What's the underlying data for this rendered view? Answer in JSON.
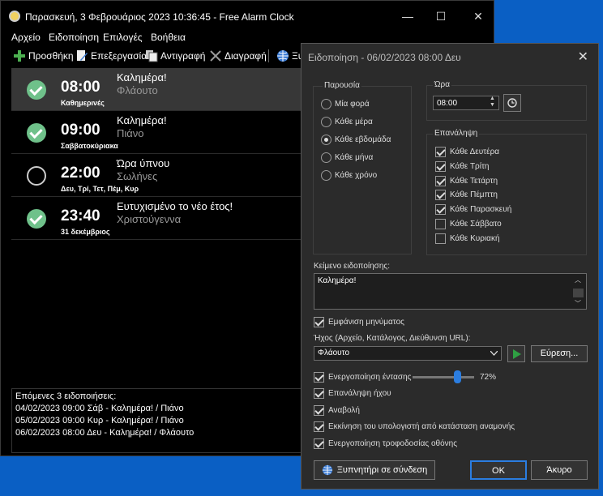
{
  "window": {
    "title": "Παρασκευή, 3 Φεβρουάριος 2023 10:36:45 - Free Alarm Clock",
    "minimize": "—",
    "maximize": "☐",
    "close": "✕"
  },
  "menu": [
    "Αρχείο",
    "Ειδοποίηση",
    "Επιλογές",
    "Βοήθεια"
  ],
  "toolbar": {
    "add": "Προσθήκη",
    "edit": "Επεξεργασία",
    "copy": "Αντιγραφή",
    "delete": "Διαγραφή",
    "wake": "Ξυ"
  },
  "alarms": [
    {
      "time": "08:00",
      "days": "Καθημερινές",
      "message": "Καλημέρα!",
      "sound": "Φλάουτο",
      "enabled": true
    },
    {
      "time": "09:00",
      "days": "Σαββατοκύριακα",
      "message": "Καλημέρα!",
      "sound": "Πιάνο",
      "enabled": true
    },
    {
      "time": "22:00",
      "days": "Δευ, Τρί, Τετ, Πέμ, Κυρ",
      "message": "Ώρα ύπνου",
      "sound": "Σωλήνες",
      "enabled": false
    },
    {
      "time": "23:40",
      "days": "31 δεκέμβριος",
      "message": "Ευτυχισμένο το νέο έτος!",
      "sound": "Χριστούγεννα",
      "enabled": true
    }
  ],
  "upcoming": {
    "header": "Επόμενες 3 ειδοποιήσεις:",
    "items": [
      "04/02/2023 09:00 Σάβ - Καλημέρα! / Πιάνο",
      "05/02/2023 09:00 Κυρ - Καλημέρα! / Πιάνο",
      "06/02/2023 08:00 Δευ - Καλημέρα! / Φλάουτο"
    ]
  },
  "dialog": {
    "title": "Ειδοποίηση - 06/02/2023 08:00 Δευ",
    "close": "✕",
    "recurrence_label": "Παρουσία",
    "recurrence": [
      "Μία φορά",
      "Κάθε μέρα",
      "Κάθε εβδομάδα",
      "Κάθε μήνα",
      "Κάθε χρόνο"
    ],
    "recurrence_selected": 2,
    "time_label": "Ώρα",
    "time_value": "08:00",
    "repeat_label": "Επανάληψη",
    "days": [
      {
        "label": "Κάθε Δευτέρα",
        "checked": true
      },
      {
        "label": "Κάθε Τρίτη",
        "checked": true
      },
      {
        "label": "Κάθε Τετάρτη",
        "checked": true
      },
      {
        "label": "Κάθε Πέμπτη",
        "checked": true
      },
      {
        "label": "Κάθε Παρασκευή",
        "checked": true
      },
      {
        "label": "Κάθε Σάββατο",
        "checked": false
      },
      {
        "label": "Κάθε Κυριακή",
        "checked": false
      }
    ],
    "message_label": "Κείμενο ειδοποίησης:",
    "message_value": "Καλημέρα!",
    "show_message": "Εμφάνιση μηνύματος",
    "sound_label": "Ήχος (Αρχείο, Κατάλογος, Διεύθυνση URL):",
    "sound_value": "Φλάουτο",
    "browse": "Εύρεση...",
    "volume_label": "Ενεργοποίηση έντασης",
    "volume_value": "72%",
    "volume_fraction": 0.72,
    "options": [
      {
        "label": "Επανάληψη ήχου",
        "checked": true
      },
      {
        "label": "Αναβολή",
        "checked": true
      },
      {
        "label": "Εκκίνηση του υπολογιστή από κατάσταση αναμονής",
        "checked": true
      },
      {
        "label": "Ενεργοποίηση τροφοδοσίας οθόνης",
        "checked": true
      }
    ],
    "wake_online": "Ξυπνητήρι σε σύνδεση",
    "ok": "OK",
    "cancel": "Άκυρο"
  },
  "colors": {
    "desktop": "#0a5fc4",
    "check_green": "#6fc18a",
    "play_green": "#2fa043"
  }
}
